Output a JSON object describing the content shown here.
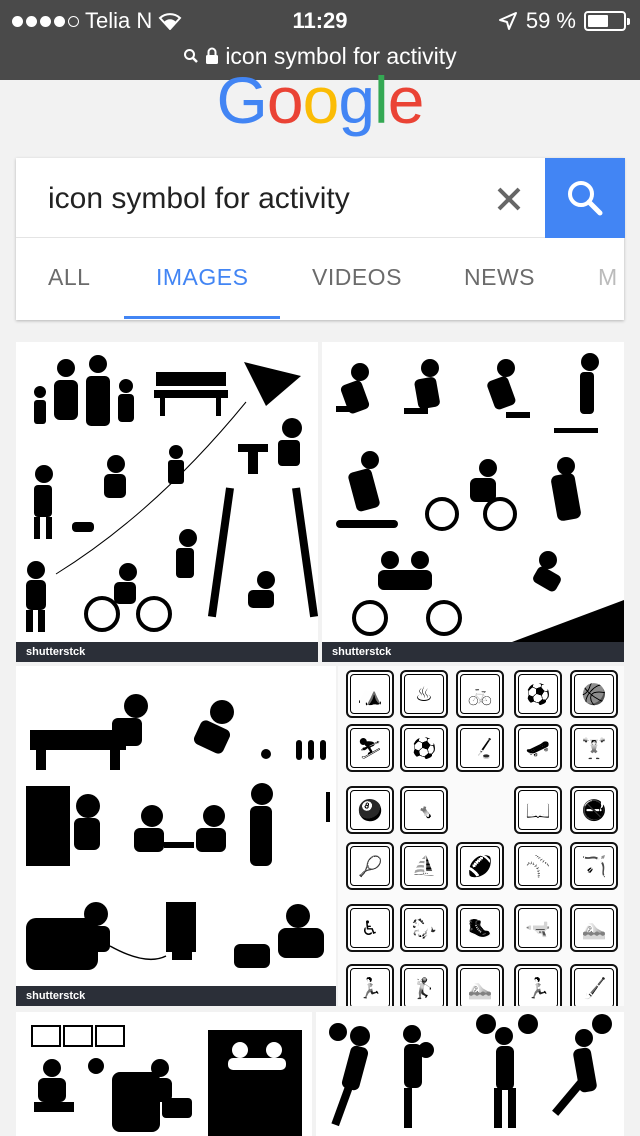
{
  "status_bar": {
    "carrier": "Telia N",
    "time": "11:29",
    "battery": "59 %",
    "battery_level": 0.59,
    "url": "icon symbol for activity"
  },
  "logo": {
    "text": "Google",
    "letters": [
      {
        "char": "G",
        "color": "#4285f4"
      },
      {
        "char": "o",
        "color": "#ea4335"
      },
      {
        "char": "o",
        "color": "#fbbc05"
      },
      {
        "char": "g",
        "color": "#4285f4"
      },
      {
        "char": "l",
        "color": "#34a853"
      },
      {
        "char": "e",
        "color": "#ea4335"
      }
    ]
  },
  "search": {
    "query": "icon symbol for activity",
    "clear_icon": "close-icon",
    "submit_icon": "search-icon"
  },
  "tabs": [
    {
      "label": "ALL",
      "active": false
    },
    {
      "label": "IMAGES",
      "active": true
    },
    {
      "label": "VIDEOS",
      "active": false
    },
    {
      "label": "NEWS",
      "active": false
    },
    {
      "label": "M",
      "active": false
    }
  ],
  "results": {
    "watermark": "shutterstck"
  },
  "colors": {
    "accent": "#4285f4",
    "status_bar": "#4a4a4a"
  }
}
